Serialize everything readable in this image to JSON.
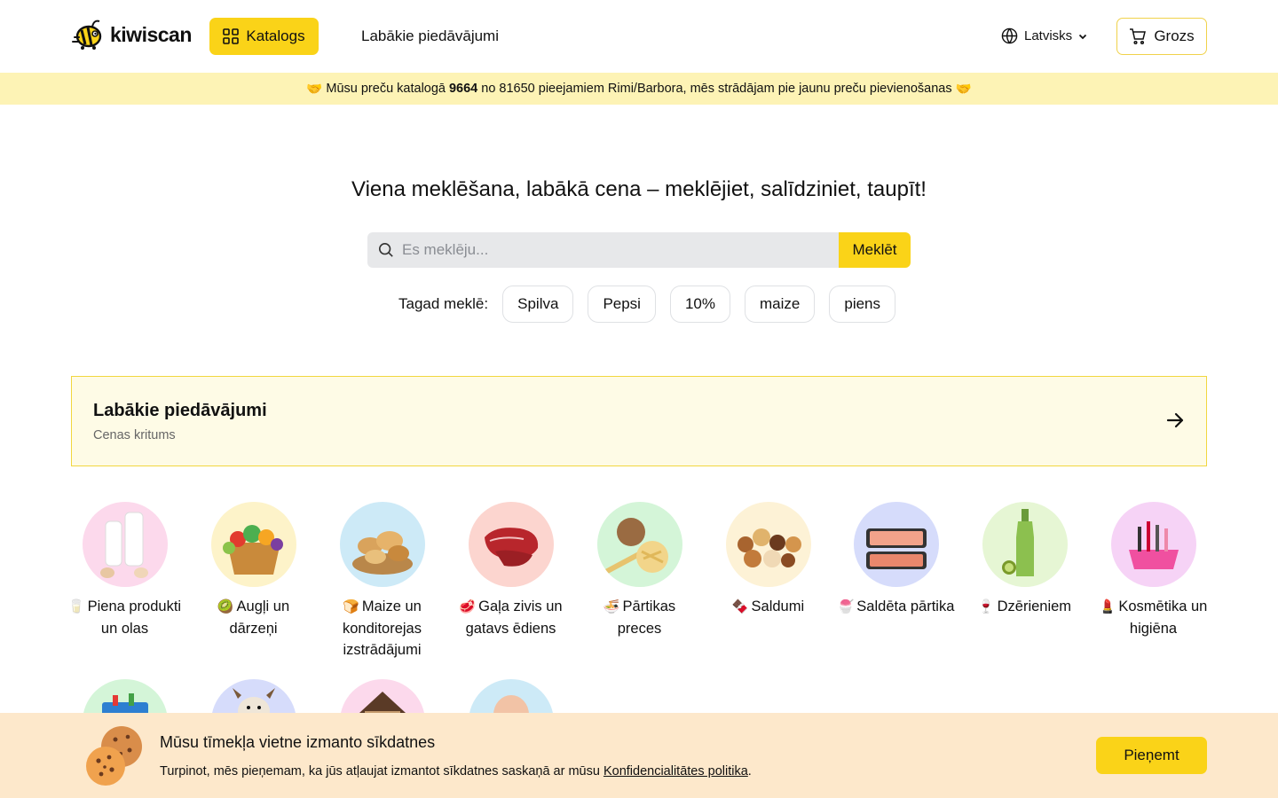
{
  "header": {
    "logo_text": "kiwiscan",
    "catalog_label": "Katalogs",
    "offers_label": "Labākie piedāvājumi",
    "language_label": "Latvisks",
    "cart_label": "Grozs"
  },
  "banner": {
    "prefix_emoji": "🤝",
    "text_before": "Mūsu preču katalogā",
    "catalog_count": "9664",
    "text_after": "no 81650 pieejamiem Rimi/Barbora, mēs strādājam pie jaunu preču pievienošanas",
    "suffix_emoji": "🤝"
  },
  "hero": {
    "title": "Viena meklēšana, labākā cena – meklējiet, salīdziniet, taupīt!",
    "search_placeholder": "Es meklēju...",
    "search_button": "Meklēt",
    "trending_label": "Tagad meklē:",
    "trending": [
      "Spilva",
      "Pepsi",
      "10%",
      "maize",
      "piens"
    ]
  },
  "deals": {
    "title": "Labākie piedāvājumi",
    "subtitle": "Cenas kritums"
  },
  "categories": [
    {
      "emoji": "🥛",
      "label": "Piena produkti un olas",
      "bg": "#fcd9ec"
    },
    {
      "emoji": "🥝",
      "label": "Augļi un dārzeņi",
      "bg": "#fdf3c9"
    },
    {
      "emoji": "🍞",
      "label": "Maize un konditorejas izstrādājumi",
      "bg": "#cdeaf7"
    },
    {
      "emoji": "🥩",
      "label": "Gaļa zivis un gatavs ēdiens",
      "bg": "#fcd5cf"
    },
    {
      "emoji": "🍜",
      "label": "Pārtikas preces",
      "bg": "#d4f5d8"
    },
    {
      "emoji": "🍫",
      "label": "Saldumi",
      "bg": "#fdf2d6"
    },
    {
      "emoji": "🍧",
      "label": "Saldēta pārtika",
      "bg": "#d6dcfb"
    },
    {
      "emoji": "🍷",
      "label": "Dzērieniem",
      "bg": "#e6f6d4"
    },
    {
      "emoji": "💄",
      "label": "Kosmētika un higiēna",
      "bg": "#f6d3f6"
    },
    {
      "emoji": "",
      "label": "",
      "bg": "#d4f5d8"
    },
    {
      "emoji": "",
      "label": "",
      "bg": "#d6dcfb"
    },
    {
      "emoji": "",
      "label": "",
      "bg": "#fcd9ec"
    },
    {
      "emoji": "",
      "label": "",
      "bg": "#cdeaf7"
    }
  ],
  "cookie": {
    "title": "Mūsu tīmekļa vietne izmanto sīkdatnes",
    "text": "Turpinot, mēs pieņemam, ka jūs atļaujat izmantot sīkdatnes saskaņā ar mūsu",
    "link": "Konfidencialitātes politika",
    "accept": "Pieņemt"
  },
  "colors": {
    "accent": "#fad318",
    "banner_bg": "#fdf3b5",
    "deals_bg": "#fefbe6",
    "cookie_bg": "#fde8cb"
  }
}
